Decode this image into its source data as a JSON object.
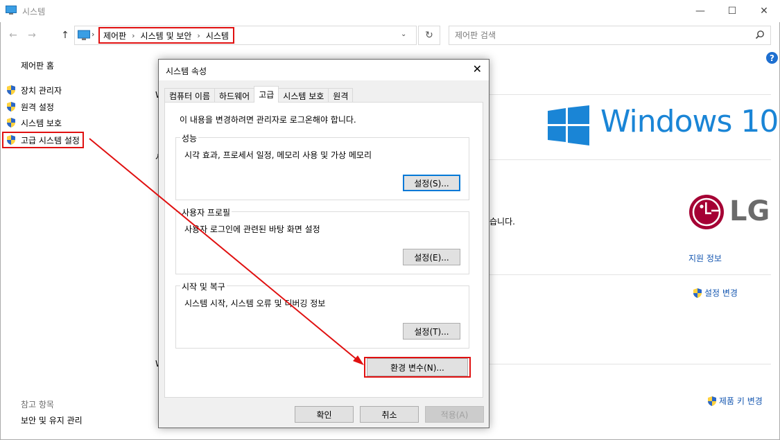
{
  "window": {
    "title": "시스템",
    "controls": {
      "minimize": "—",
      "maximize": "☐",
      "close": "✕"
    }
  },
  "nav": {
    "back": "←",
    "forward": "→",
    "up": "↑"
  },
  "address": {
    "crumbs": [
      "제어판",
      "시스템 및 보안",
      "시스템"
    ],
    "dropdown": "⌄",
    "refresh": "↻"
  },
  "search": {
    "placeholder": "제어판 검색",
    "icon": "search-icon"
  },
  "sidebar": {
    "home": "제어판 홈",
    "items": [
      {
        "label": "장치 관리자",
        "icon": "uac-shield-icon"
      },
      {
        "label": "원격 설정",
        "icon": "uac-shield-icon"
      },
      {
        "label": "시스템 보호",
        "icon": "uac-shield-icon"
      },
      {
        "label": "고급 시스템 설정",
        "icon": "uac-shield-icon",
        "highlighted": true
      }
    ],
    "see_also_title": "참고 항목",
    "see_also_link": "보안 및 유지 관리"
  },
  "main": {
    "help": "?",
    "windows_logo_text": "Windows 10",
    "oem_logo_text": "LG",
    "partial_text": "습니다.",
    "support_link": "지원 정보",
    "change_settings": "설정 변경",
    "change_key": "제품 키 변경",
    "peek_letters": [
      "W",
      "시",
      "W"
    ]
  },
  "dialog": {
    "title": "시스템 속성",
    "close": "✕",
    "tabs": [
      "컴퓨터 이름",
      "하드웨어",
      "고급",
      "시스템 보호",
      "원격"
    ],
    "active_tab": "고급",
    "admin_note": "이 내용을 변경하려면 관리자로 로그온해야 합니다.",
    "groups": {
      "performance": {
        "label": "성능",
        "desc": "시각 효과, 프로세서 일정, 메모리 사용 및 가상 메모리",
        "button": "설정(S)..."
      },
      "profiles": {
        "label": "사용자 프로필",
        "desc": "사용자 로그인에 관련된 바탕 화면 설정",
        "button": "설정(E)..."
      },
      "startup": {
        "label": "시작 및 복구",
        "desc": "시스템 시작, 시스템 오류 및 디버깅 정보",
        "button": "설정(T)..."
      }
    },
    "env_button": "환경 변수(N)...",
    "ok": "확인",
    "cancel": "취소",
    "apply": "적용(A)"
  },
  "colors": {
    "highlight_red": "#e01010",
    "windows_blue": "#1a85d6",
    "link_blue": "#1456b0",
    "lg_red": "#a50034",
    "lg_gray": "#6b6b6b"
  }
}
